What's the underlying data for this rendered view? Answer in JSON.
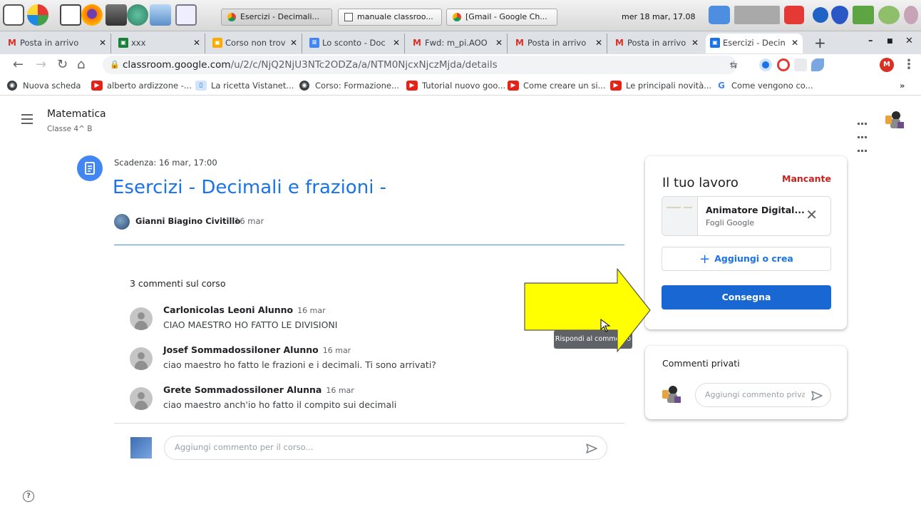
{
  "taskbar": {
    "tasks": [
      {
        "label": "Esercizi - Decimali..."
      },
      {
        "label": "manuale classroo..."
      },
      {
        "label": "[Gmail - Google Ch..."
      }
    ],
    "clock": "mer 18 mar, 17.08"
  },
  "browser": {
    "tabs": [
      {
        "label": "Posta in arrivo"
      },
      {
        "label": "xxx"
      },
      {
        "label": "Corso non trov"
      },
      {
        "label": "Lo sconto - Doc"
      },
      {
        "label": "Fwd: m_pi.AOO"
      },
      {
        "label": "Posta in arrivo"
      },
      {
        "label": "Posta in arrivo"
      },
      {
        "label": "Esercizi - Decin"
      }
    ],
    "new_tab_label": "+",
    "url_host": "classroom.google.com",
    "url_path": "/u/2/c/NjQ2NjU3NTc2ODZa/a/NTM0NjcxNjczMjda/details",
    "profile_initial": "M",
    "bookmarks": [
      {
        "label": "Nuova scheda",
        "icon": "globe-icon"
      },
      {
        "label": "alberto ardizzone -...",
        "icon": "youtube-icon"
      },
      {
        "label": "La ricetta Vistanet...",
        "icon": "page-icon"
      },
      {
        "label": "Corso: Formazione...",
        "icon": "globe-icon"
      },
      {
        "label": "Tutorial nuovo goo...",
        "icon": "youtube-icon"
      },
      {
        "label": "Come creare un si...",
        "icon": "youtube-icon"
      },
      {
        "label": "Le principali novità...",
        "icon": "youtube-icon"
      },
      {
        "label": "Come vengono co...",
        "icon": "google-icon"
      }
    ],
    "bookmarks_more": "»"
  },
  "classroom": {
    "course_name": "Matematica",
    "section": "Classe 4^ B"
  },
  "assignment": {
    "due": "Scadenza: 16 mar, 17:00",
    "title": "Esercizi - Decimali e frazioni -",
    "author": "Gianni Biagino Civitillo",
    "date": "16 mar"
  },
  "comments": {
    "count_label": "3 commenti sul corso",
    "items": [
      {
        "author": "Carlonicolas Leoni Alunno",
        "date": "16 mar",
        "text": "CIAO MAESTRO HO FATTO LE DIVISIONI"
      },
      {
        "author": "Josef Sommadossiloner Alunno",
        "date": "16 mar",
        "text": "ciao maestro ho fatto le frazioni e i decimali. Ti sono arrivati?"
      },
      {
        "author": "Grete Sommadossiloner Alunna",
        "date": "16 mar",
        "text": "ciao maestro anch'io ho fatto il compito sui decimali"
      }
    ],
    "input_placeholder": "Aggiungi commento per il corso...",
    "tooltip": "Rispondi al commento"
  },
  "work": {
    "title": "Il tuo lavoro",
    "status": "Mancante",
    "status_color": "#c5221f",
    "attachment": {
      "name": "Animatore Digital...",
      "type": "Fogli Google"
    },
    "add_label": "Aggiungi o crea",
    "submit_label": "Consegna",
    "accent": "#1967d2"
  },
  "private_comments": {
    "title": "Commenti privati",
    "input_placeholder": "Aggiungi commento privato"
  },
  "annotation": {
    "arrow_color": "#ffff00"
  }
}
